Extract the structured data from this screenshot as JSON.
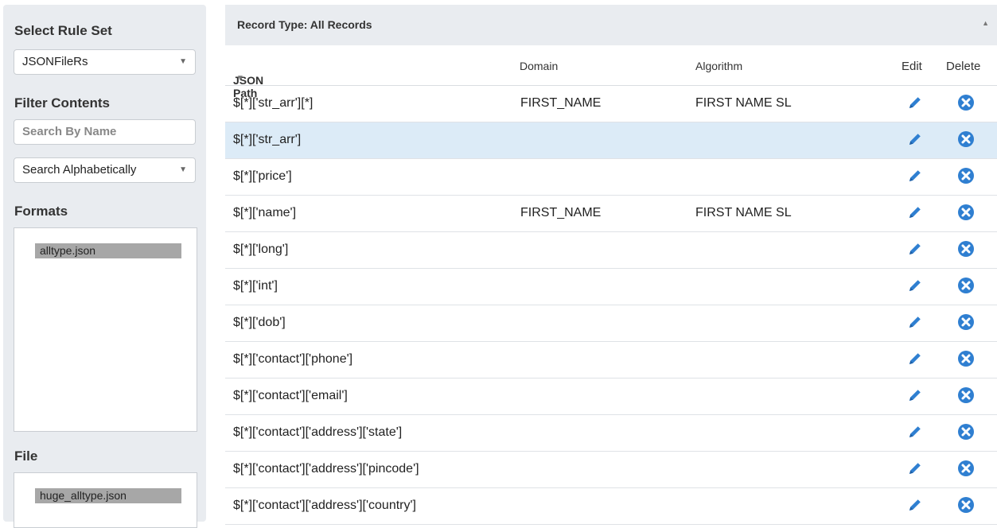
{
  "sidebar": {
    "rule_set_heading": "Select Rule Set",
    "rule_set_value": "JSONFileRs",
    "filter_heading": "Filter Contents",
    "search_placeholder": "Search By Name",
    "sort_value": "Search Alphabetically",
    "formats_heading": "Formats",
    "formats_items": [
      "alltype.json"
    ],
    "file_heading": "File",
    "file_items": [
      "huge_alltype.json"
    ]
  },
  "main": {
    "record_type": "Record Type: All Records",
    "columns": {
      "json_path": "JSON Path",
      "domain": "Domain",
      "algorithm": "Algorithm",
      "edit": "Edit",
      "delete": "Delete"
    },
    "rows": [
      {
        "path": "$[*]['str_arr'][*]",
        "domain": "FIRST_NAME",
        "algorithm": "FIRST NAME SL"
      },
      {
        "path": "$[*]['str_arr']",
        "domain": "",
        "algorithm": ""
      },
      {
        "path": "$[*]['price']",
        "domain": "",
        "algorithm": ""
      },
      {
        "path": "$[*]['name']",
        "domain": "FIRST_NAME",
        "algorithm": "FIRST NAME SL"
      },
      {
        "path": "$[*]['long']",
        "domain": "",
        "algorithm": ""
      },
      {
        "path": "$[*]['int']",
        "domain": "",
        "algorithm": ""
      },
      {
        "path": "$[*]['dob']",
        "domain": "",
        "algorithm": ""
      },
      {
        "path": "$[*]['contact']['phone']",
        "domain": "",
        "algorithm": ""
      },
      {
        "path": "$[*]['contact']['email']",
        "domain": "",
        "algorithm": ""
      },
      {
        "path": "$[*]['contact']['address']['state']",
        "domain": "",
        "algorithm": ""
      },
      {
        "path": "$[*]['contact']['address']['pincode']",
        "domain": "",
        "algorithm": ""
      },
      {
        "path": "$[*]['contact']['address']['country']",
        "domain": "",
        "algorithm": ""
      }
    ],
    "selected_row": 1
  },
  "icons": {
    "edit": "pencil-icon",
    "delete": "circle-x-icon",
    "select_caret": "caret-down-icon",
    "sort_caret": "sort-down-icon",
    "collapse": "caret-up-icon"
  },
  "colors": {
    "accent_blue": "#2f7fd1",
    "selected_row": "#dcebf7",
    "panel_bg": "#e9ecf0",
    "list_selection": "#a7a7a7"
  }
}
